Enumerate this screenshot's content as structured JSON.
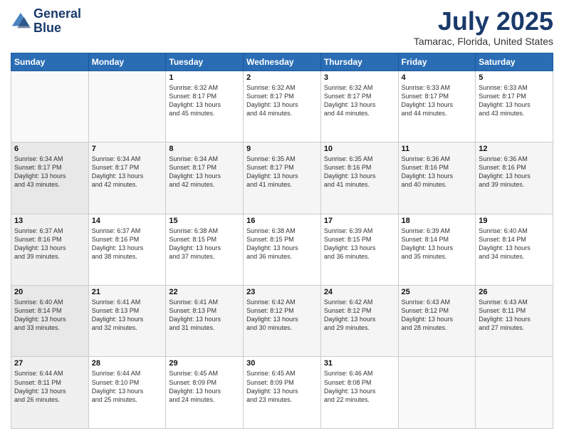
{
  "header": {
    "logo_line1": "General",
    "logo_line2": "Blue",
    "month_title": "July 2025",
    "location": "Tamarac, Florida, United States"
  },
  "days_of_week": [
    "Sunday",
    "Monday",
    "Tuesday",
    "Wednesday",
    "Thursday",
    "Friday",
    "Saturday"
  ],
  "weeks": [
    [
      {
        "day": "",
        "info": ""
      },
      {
        "day": "",
        "info": ""
      },
      {
        "day": "1",
        "info": "Sunrise: 6:32 AM\nSunset: 8:17 PM\nDaylight: 13 hours\nand 45 minutes."
      },
      {
        "day": "2",
        "info": "Sunrise: 6:32 AM\nSunset: 8:17 PM\nDaylight: 13 hours\nand 44 minutes."
      },
      {
        "day": "3",
        "info": "Sunrise: 6:32 AM\nSunset: 8:17 PM\nDaylight: 13 hours\nand 44 minutes."
      },
      {
        "day": "4",
        "info": "Sunrise: 6:33 AM\nSunset: 8:17 PM\nDaylight: 13 hours\nand 44 minutes."
      },
      {
        "day": "5",
        "info": "Sunrise: 6:33 AM\nSunset: 8:17 PM\nDaylight: 13 hours\nand 43 minutes."
      }
    ],
    [
      {
        "day": "6",
        "info": "Sunrise: 6:34 AM\nSunset: 8:17 PM\nDaylight: 13 hours\nand 43 minutes."
      },
      {
        "day": "7",
        "info": "Sunrise: 6:34 AM\nSunset: 8:17 PM\nDaylight: 13 hours\nand 42 minutes."
      },
      {
        "day": "8",
        "info": "Sunrise: 6:34 AM\nSunset: 8:17 PM\nDaylight: 13 hours\nand 42 minutes."
      },
      {
        "day": "9",
        "info": "Sunrise: 6:35 AM\nSunset: 8:17 PM\nDaylight: 13 hours\nand 41 minutes."
      },
      {
        "day": "10",
        "info": "Sunrise: 6:35 AM\nSunset: 8:16 PM\nDaylight: 13 hours\nand 41 minutes."
      },
      {
        "day": "11",
        "info": "Sunrise: 6:36 AM\nSunset: 8:16 PM\nDaylight: 13 hours\nand 40 minutes."
      },
      {
        "day": "12",
        "info": "Sunrise: 6:36 AM\nSunset: 8:16 PM\nDaylight: 13 hours\nand 39 minutes."
      }
    ],
    [
      {
        "day": "13",
        "info": "Sunrise: 6:37 AM\nSunset: 8:16 PM\nDaylight: 13 hours\nand 39 minutes."
      },
      {
        "day": "14",
        "info": "Sunrise: 6:37 AM\nSunset: 8:16 PM\nDaylight: 13 hours\nand 38 minutes."
      },
      {
        "day": "15",
        "info": "Sunrise: 6:38 AM\nSunset: 8:15 PM\nDaylight: 13 hours\nand 37 minutes."
      },
      {
        "day": "16",
        "info": "Sunrise: 6:38 AM\nSunset: 8:15 PM\nDaylight: 13 hours\nand 36 minutes."
      },
      {
        "day": "17",
        "info": "Sunrise: 6:39 AM\nSunset: 8:15 PM\nDaylight: 13 hours\nand 36 minutes."
      },
      {
        "day": "18",
        "info": "Sunrise: 6:39 AM\nSunset: 8:14 PM\nDaylight: 13 hours\nand 35 minutes."
      },
      {
        "day": "19",
        "info": "Sunrise: 6:40 AM\nSunset: 8:14 PM\nDaylight: 13 hours\nand 34 minutes."
      }
    ],
    [
      {
        "day": "20",
        "info": "Sunrise: 6:40 AM\nSunset: 8:14 PM\nDaylight: 13 hours\nand 33 minutes."
      },
      {
        "day": "21",
        "info": "Sunrise: 6:41 AM\nSunset: 8:13 PM\nDaylight: 13 hours\nand 32 minutes."
      },
      {
        "day": "22",
        "info": "Sunrise: 6:41 AM\nSunset: 8:13 PM\nDaylight: 13 hours\nand 31 minutes."
      },
      {
        "day": "23",
        "info": "Sunrise: 6:42 AM\nSunset: 8:12 PM\nDaylight: 13 hours\nand 30 minutes."
      },
      {
        "day": "24",
        "info": "Sunrise: 6:42 AM\nSunset: 8:12 PM\nDaylight: 13 hours\nand 29 minutes."
      },
      {
        "day": "25",
        "info": "Sunrise: 6:43 AM\nSunset: 8:12 PM\nDaylight: 13 hours\nand 28 minutes."
      },
      {
        "day": "26",
        "info": "Sunrise: 6:43 AM\nSunset: 8:11 PM\nDaylight: 13 hours\nand 27 minutes."
      }
    ],
    [
      {
        "day": "27",
        "info": "Sunrise: 6:44 AM\nSunset: 8:11 PM\nDaylight: 13 hours\nand 26 minutes."
      },
      {
        "day": "28",
        "info": "Sunrise: 6:44 AM\nSunset: 8:10 PM\nDaylight: 13 hours\nand 25 minutes."
      },
      {
        "day": "29",
        "info": "Sunrise: 6:45 AM\nSunset: 8:09 PM\nDaylight: 13 hours\nand 24 minutes."
      },
      {
        "day": "30",
        "info": "Sunrise: 6:45 AM\nSunset: 8:09 PM\nDaylight: 13 hours\nand 23 minutes."
      },
      {
        "day": "31",
        "info": "Sunrise: 6:46 AM\nSunset: 8:08 PM\nDaylight: 13 hours\nand 22 minutes."
      },
      {
        "day": "",
        "info": ""
      },
      {
        "day": "",
        "info": ""
      }
    ]
  ]
}
